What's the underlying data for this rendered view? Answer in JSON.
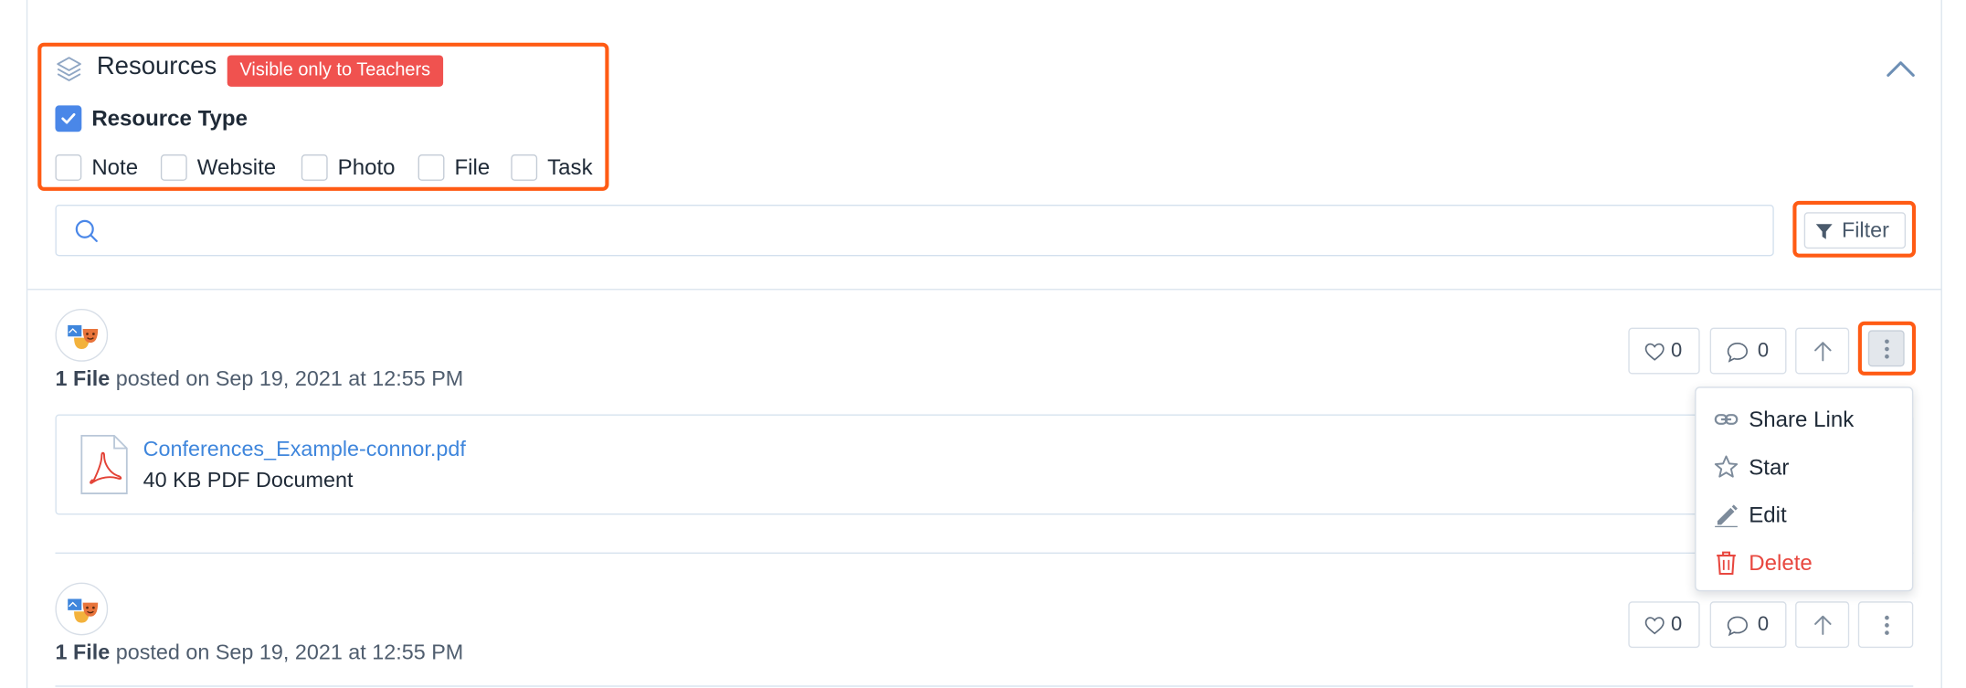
{
  "resources": {
    "title": "Resources",
    "badge": "Visible only to Teachers",
    "resource_type_label": "Resource Type",
    "resource_type_checked": true,
    "options": [
      {
        "label": "Note",
        "checked": false
      },
      {
        "label": "Website",
        "checked": false
      },
      {
        "label": "Photo",
        "checked": false
      },
      {
        "label": "File",
        "checked": false
      },
      {
        "label": "Task",
        "checked": false
      }
    ]
  },
  "search": {
    "value": "",
    "placeholder": ""
  },
  "filter": {
    "label": "Filter"
  },
  "posts": [
    {
      "kind": "1 File",
      "posted_text": "posted on Sep 19, 2021 at 12:55 PM",
      "likes": "0",
      "comments": "0",
      "file": {
        "name": "Conferences_Example-connor.pdf",
        "description": "40 KB PDF Document"
      }
    },
    {
      "kind": "1 File",
      "posted_text": "posted on Sep 19, 2021 at 12:55 PM",
      "likes": "0",
      "comments": "0"
    }
  ],
  "menu": {
    "items": [
      {
        "label": "Share Link",
        "icon": "link-icon"
      },
      {
        "label": "Star",
        "icon": "star-icon"
      },
      {
        "label": "Edit",
        "icon": "pencil-icon"
      },
      {
        "label": "Delete",
        "icon": "trash-icon",
        "danger": true
      }
    ]
  },
  "colors": {
    "highlight": "#ff5b14",
    "badge": "#f0524f",
    "checkbox": "#4a87e8",
    "link": "#3f86dc",
    "danger": "#e8473f"
  }
}
